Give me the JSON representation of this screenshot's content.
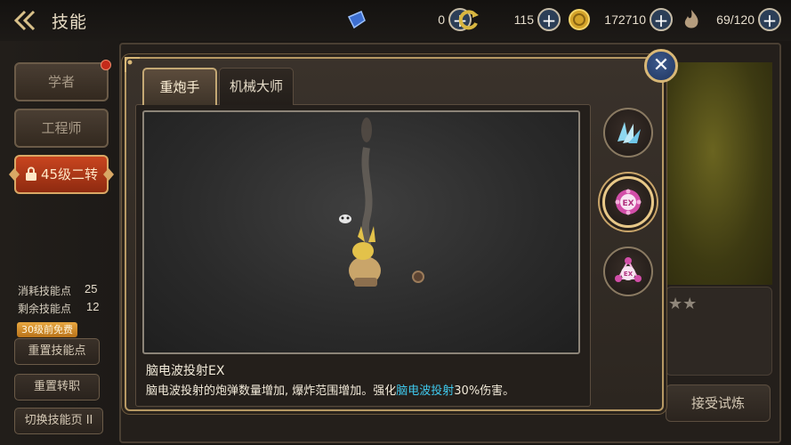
{
  "header": {
    "title": "技能",
    "resources": [
      {
        "icon": "blue-crystal-icon",
        "value": "0"
      },
      {
        "icon": "yellow-refresh-icon",
        "value": "115"
      },
      {
        "icon": "gold-coin-icon",
        "value": "172710"
      },
      {
        "icon": "stamina-flame-icon",
        "value": "69/120"
      }
    ]
  },
  "sidebar": {
    "classes": [
      {
        "label": "学者"
      },
      {
        "label": "工程师"
      },
      {
        "label": "45级二转"
      }
    ],
    "stats": [
      {
        "label": "消耗技能点",
        "value": "25"
      },
      {
        "label": "剩余技能点",
        "value": "12"
      }
    ],
    "free_badge": "30级前免费",
    "buttons": [
      "重置技能点",
      "重置转职",
      "切换技能页 II"
    ]
  },
  "dialog": {
    "tabs": [
      {
        "label": "重炮手",
        "active": true
      },
      {
        "label": "机械大师",
        "active": false
      }
    ],
    "skill_name": "脑电波投射EX",
    "desc_before": "脑电波投射的炮弹数量增加, 爆炸范围增加。强化",
    "desc_highlight": "脑电波投射",
    "desc_after": "30%伤害。",
    "skill_icons": [
      "feather-burst-icon",
      "ex-core-icon",
      "ex-network-icon"
    ],
    "close_symbol": "✕"
  },
  "right_panel": {
    "stars": "★★",
    "trial_button": "接受试炼"
  },
  "colors": {
    "highlight": "#3fc8ec",
    "active_job": "#c9451f",
    "frame_gold": "#b79964"
  }
}
